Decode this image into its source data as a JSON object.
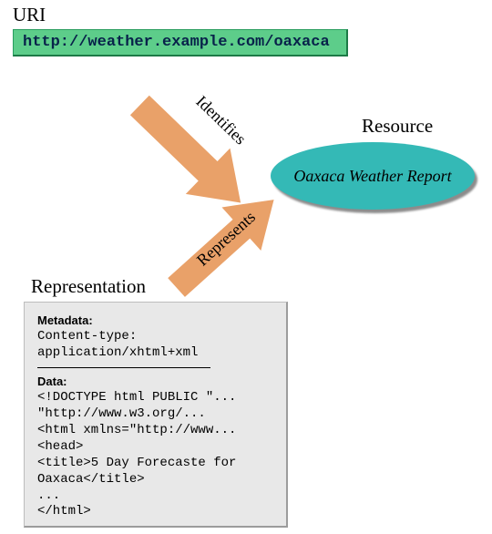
{
  "uri": {
    "label": "URI",
    "value": "http://weather.example.com/oaxaca"
  },
  "resource": {
    "label": "Resource",
    "name": "Oaxaca Weather Report"
  },
  "representation": {
    "label": "Representation",
    "metadata_heading": "Metadata:",
    "metadata_lines": [
      "Content-type:",
      "application/xhtml+xml"
    ],
    "data_heading": "Data:",
    "data_lines": [
      "<!DOCTYPE html PUBLIC \"...",
      "   \"http://www.w3.org/...",
      "<html xmlns=\"http://www...",
      "<head>",
      "<title>5 Day Forecaste for",
      "Oaxaca</title>",
      "...",
      "</html>"
    ]
  },
  "arrows": {
    "identifies": "Identifies",
    "represents": "Represents"
  },
  "colors": {
    "uri_bg": "#5dcd8a",
    "resource_bg": "#34b9b6",
    "arrow_fill": "#e9a169",
    "rep_bg": "#e8e8e8"
  }
}
